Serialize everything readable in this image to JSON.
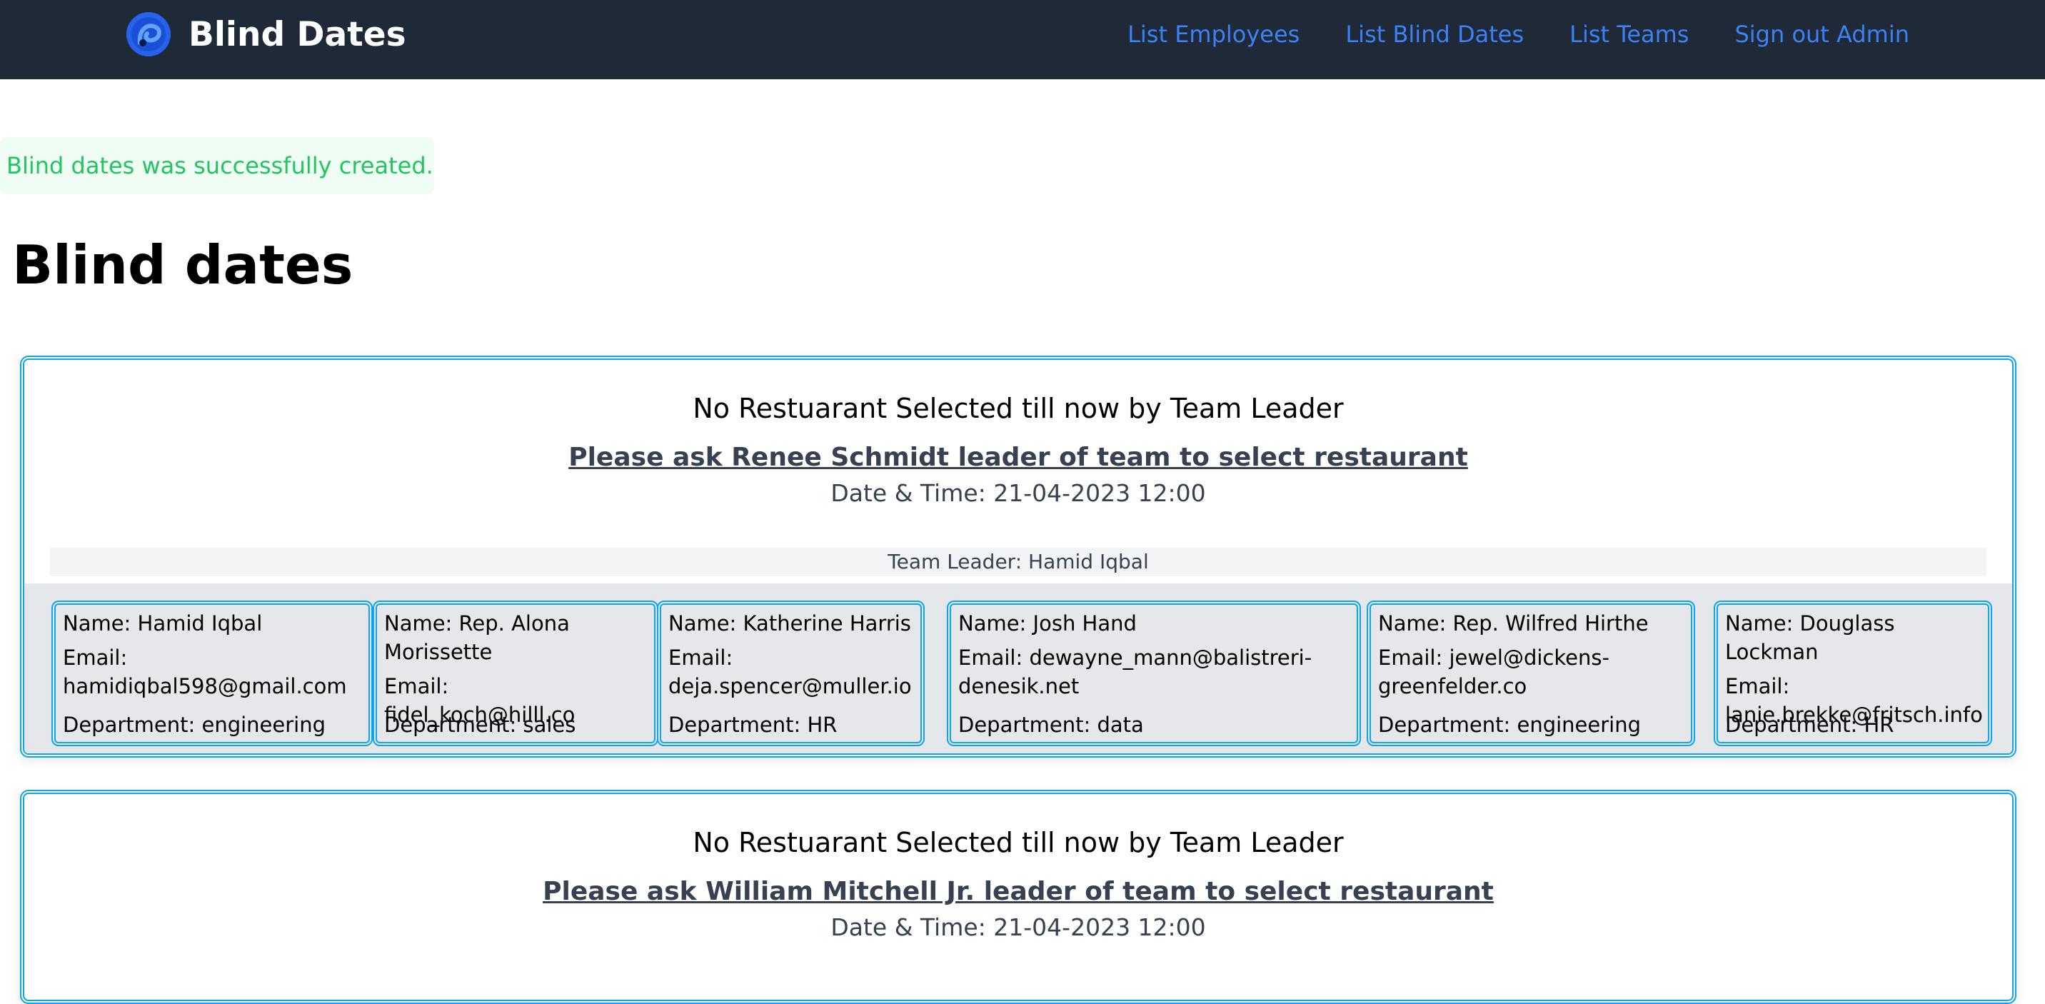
{
  "header": {
    "brand": "Blind Dates",
    "nav": [
      {
        "label": "List Employees"
      },
      {
        "label": "List Blind Dates"
      },
      {
        "label": "List Teams"
      },
      {
        "label": "Sign out Admin"
      }
    ]
  },
  "notice": "Blind dates was successfully created.",
  "page_title": "Blind dates",
  "dates": [
    {
      "no_restaurant": "No Restuarant Selected till now by Team Leader",
      "ask_text": "Please ask Renee Schmidt leader of team to select restaurant",
      "datetime": "Date & Time: 21-04-2023 12:00",
      "leader": "Team Leader: Hamid Iqbal",
      "members": [
        {
          "name": "Name: Hamid Iqbal",
          "email": "Email: hamidiqbal598@gmail.com",
          "department": "Department: engineering"
        },
        {
          "name": "Name: Rep. Alona Morissette",
          "email": "Email: fidel_koch@hilll.co",
          "department": "Department: sales"
        },
        {
          "name": "Name: Katherine Harris",
          "email": "Email: deja.spencer@muller.io",
          "department": "Department: HR"
        },
        {
          "name": "Name: Josh Hand",
          "email": "Email: dewayne_mann@balistreri-denesik.net",
          "department": "Department: data"
        },
        {
          "name": "Name: Rep. Wilfred Hirthe",
          "email": "Email: jewel@dickens-greenfelder.co",
          "department": "Department: engineering"
        },
        {
          "name": "Name: Douglass Lockman",
          "email": "Email: lanie.brekke@fritsch.info",
          "department": "Department: HR"
        }
      ]
    },
    {
      "no_restaurant": "No Restuarant Selected till now by Team Leader",
      "ask_text": "Please ask William Mitchell Jr. leader of team to select restaurant",
      "datetime": "Date & Time: 21-04-2023 12:00"
    }
  ],
  "colors": {
    "nav_bg": "#1f2937",
    "link": "#3b82f6",
    "success": "#22c55e",
    "card_border": "#0ea5e9"
  }
}
